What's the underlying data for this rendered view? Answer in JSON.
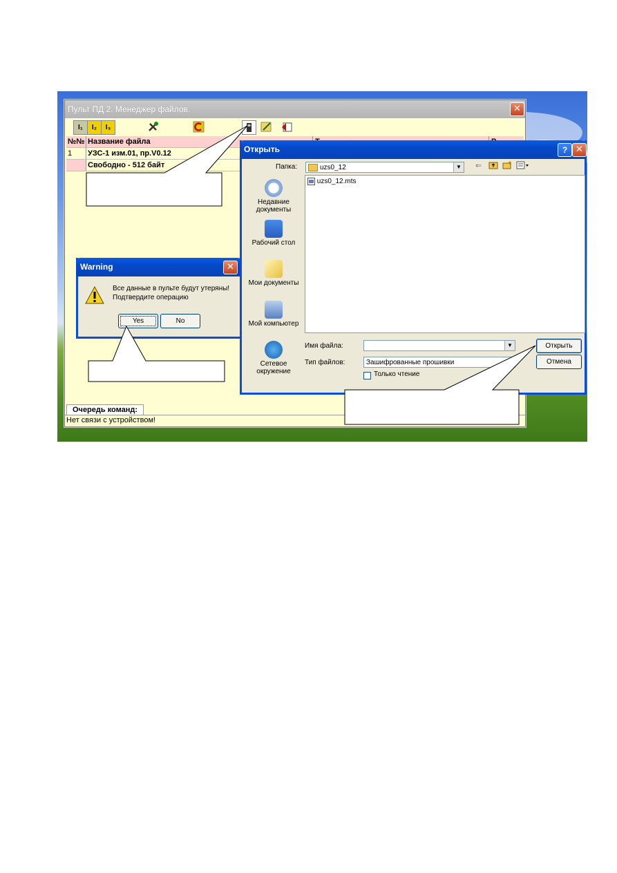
{
  "main_window": {
    "title": "Пульт ПД 2. Менеджер файлов.",
    "close": "✕",
    "toolbar": {
      "btn1": "I₁",
      "btn2": "I₂",
      "btn3": "I₃"
    },
    "table": {
      "col_no": "№№",
      "col_name": "Название файла",
      "col_type": "Т...",
      "col_size": "Р...",
      "rows": [
        {
          "no": "1",
          "name": "УЗС-1 изм.01, пр.V0.12"
        },
        {
          "no": "",
          "name": "Свободно - 512 байт"
        }
      ]
    },
    "queue_tab": "Очередь команд:",
    "status": "Нет связи с устройством!"
  },
  "warning": {
    "title": "Warning",
    "close": "✕",
    "message_line1": "Все данные в пульте будут утеряны!",
    "message_line2": "Подтвердите операцию",
    "yes": "Yes",
    "no": "No"
  },
  "open_dialog": {
    "title": "Открыть",
    "help": "?",
    "close": "✕",
    "folder_label": "Папка:",
    "folder_value": "uzs0_12",
    "places": [
      {
        "line1": "Недавние",
        "line2": "документы"
      },
      {
        "line1": "Рабочий стол",
        "line2": ""
      },
      {
        "line1": "Мои документы",
        "line2": ""
      },
      {
        "line1": "Мой компьютер",
        "line2": ""
      },
      {
        "line1": "Сетевое",
        "line2": "окружение"
      }
    ],
    "file": "uzs0_12.mts",
    "filename_label": "Имя файла:",
    "filename_value": "",
    "filetype_label": "Тип файлов:",
    "filetype_value": "Зашифрованные прошивки",
    "readonly_label": "Только чтение",
    "open_button": "Открыть",
    "cancel_button": "Отмена"
  },
  "colors": {
    "title_blue": "#0a5ce6",
    "window_bg": "#fffed2",
    "dialog_bg": "#ece9d8",
    "header_pink": "#ffd0d0"
  }
}
